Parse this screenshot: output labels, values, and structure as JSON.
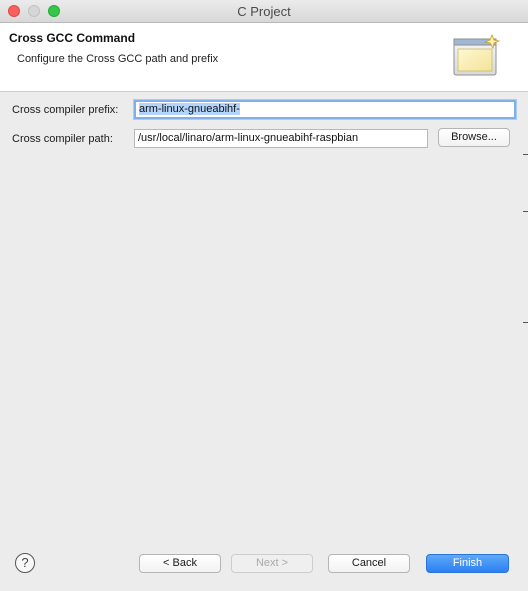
{
  "window": {
    "title": "C Project"
  },
  "banner": {
    "title": "Cross GCC Command",
    "description": "Configure the Cross GCC path and prefix",
    "icon": "wizard-banner-icon"
  },
  "form": {
    "prefix": {
      "label": "Cross compiler prefix:",
      "value": "arm-linux-gnueabihf-"
    },
    "path": {
      "label": "Cross compiler path:",
      "value": "/usr/local/linaro/arm-linux-gnueabihf-raspbian",
      "browse_label": "Browse..."
    }
  },
  "footer": {
    "help_icon": "question-mark-icon",
    "help_glyph": "?",
    "back_label": "< Back",
    "next_label": "Next >",
    "cancel_label": "Cancel",
    "finish_label": "Finish"
  },
  "colors": {
    "accent": "#2c7ff3",
    "selection": "#b3d4fc",
    "close": "#fc605c",
    "maximize": "#34c84a"
  }
}
